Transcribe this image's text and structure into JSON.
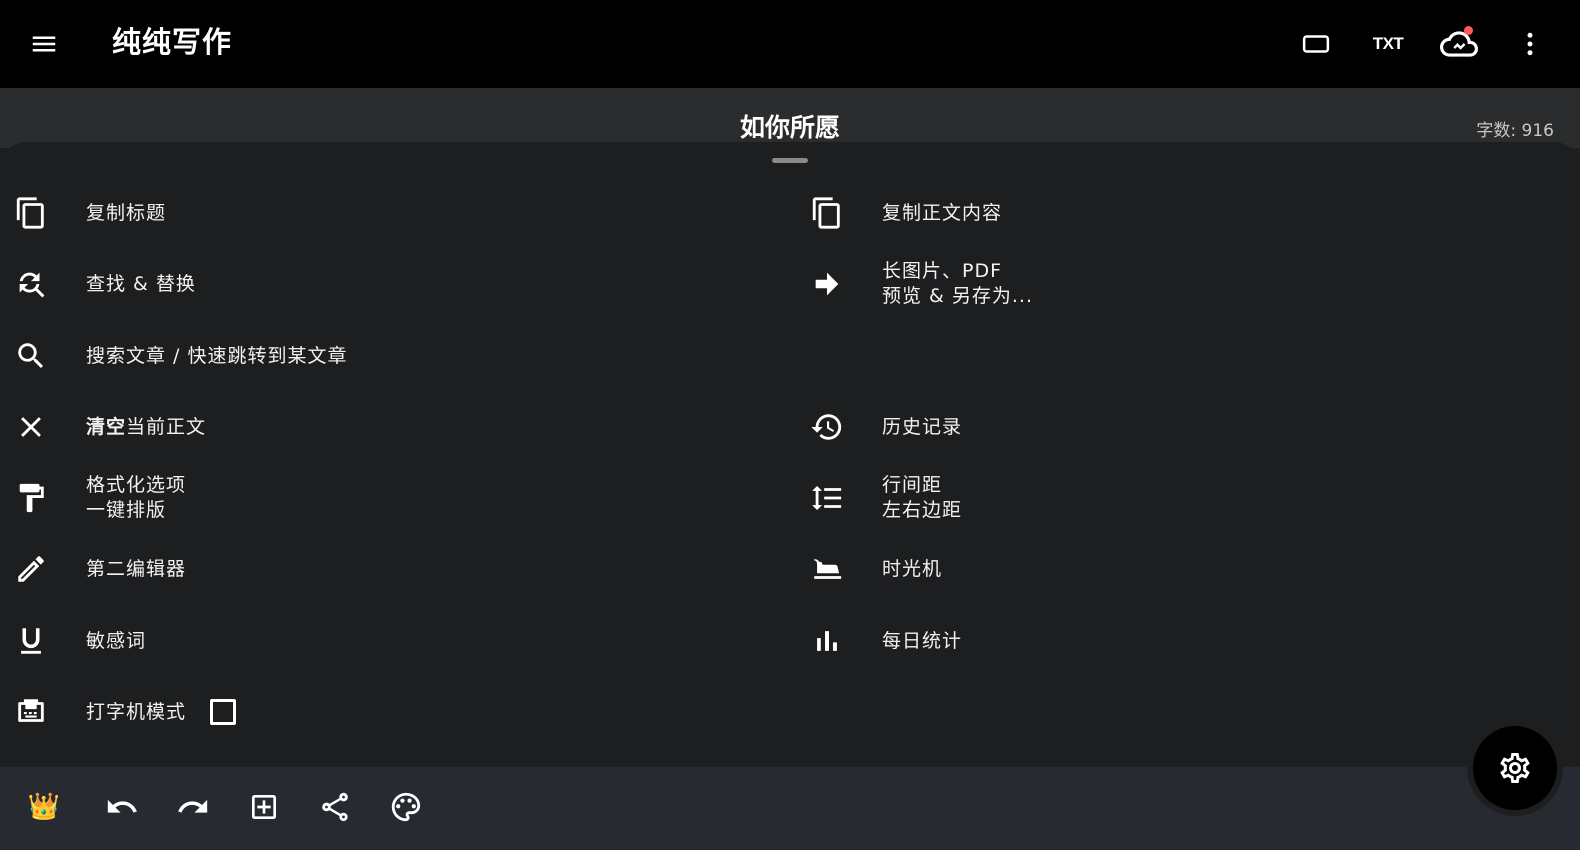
{
  "app": {
    "title": "纯纯写作"
  },
  "toolbar": {
    "txt_label": "TXT"
  },
  "document": {
    "title": "如你所愿",
    "word_count": "字数: 916"
  },
  "menu": {
    "left": [
      {
        "label": "复制标题",
        "icon": "copy-icon"
      },
      {
        "label": "查找 & 替换",
        "icon": "find-replace-icon"
      },
      {
        "label": "搜索文章 / 快速跳转到某文章",
        "icon": "search-icon"
      },
      {
        "label_bold": "清空",
        "label_rest": "当前正文",
        "icon": "close-icon"
      },
      {
        "line1": "格式化选项",
        "line2": "一键排版",
        "icon": "format-paint-icon"
      },
      {
        "label": "第二编辑器",
        "icon": "pencil-icon"
      },
      {
        "label": "敏感词",
        "icon": "underline-icon"
      },
      {
        "label": "打字机模式",
        "icon": "typewriter-icon",
        "checked": false
      }
    ],
    "right": [
      {
        "label": "复制正文内容",
        "icon": "copy-icon"
      },
      {
        "line1": "长图片、PDF",
        "line2": "预览 & 另存为...",
        "icon": "arrow-right-icon"
      },
      {
        "label": "历史记录",
        "icon": "history-icon"
      },
      {
        "line1": "行间距",
        "line2": "左右边距",
        "icon": "line-spacing-icon"
      },
      {
        "label": "时光机",
        "icon": "time-machine-icon"
      },
      {
        "label": "每日统计",
        "icon": "bar-chart-icon"
      }
    ]
  },
  "bottom_bar": {
    "crown": "👑"
  },
  "colors": {
    "accent_dot": "#ff5a5a",
    "appbar": "#000000",
    "sheet": "#1d1e20",
    "bottom_bar": "#272a31"
  }
}
